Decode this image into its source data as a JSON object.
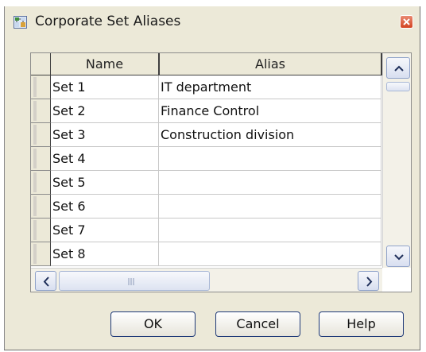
{
  "window": {
    "title": "Corporate Set Aliases"
  },
  "table": {
    "columns": [
      "Name",
      "Alias"
    ],
    "rows": [
      {
        "name": "Set 1",
        "alias": "IT department"
      },
      {
        "name": "Set 2",
        "alias": "Finance Control"
      },
      {
        "name": "Set 3",
        "alias": "Construction division"
      },
      {
        "name": "Set 4",
        "alias": ""
      },
      {
        "name": "Set 5",
        "alias": ""
      },
      {
        "name": "Set 6",
        "alias": ""
      },
      {
        "name": "Set 7",
        "alias": ""
      },
      {
        "name": "Set 8",
        "alias": ""
      }
    ]
  },
  "buttons": {
    "ok": "OK",
    "cancel": "Cancel",
    "help": "Help"
  },
  "icons": {
    "title": "corporate-set-icon",
    "close": "close-icon",
    "scroll_up": "chevron-up-icon",
    "scroll_down": "chevron-down-icon",
    "scroll_left": "chevron-left-icon",
    "scroll_right": "chevron-right-icon",
    "grip": "scroll-grip-icon"
  },
  "colors": {
    "close_button": "#d34321",
    "dialog_bg": "#ece9d8",
    "button_border": "#1f3a78"
  }
}
